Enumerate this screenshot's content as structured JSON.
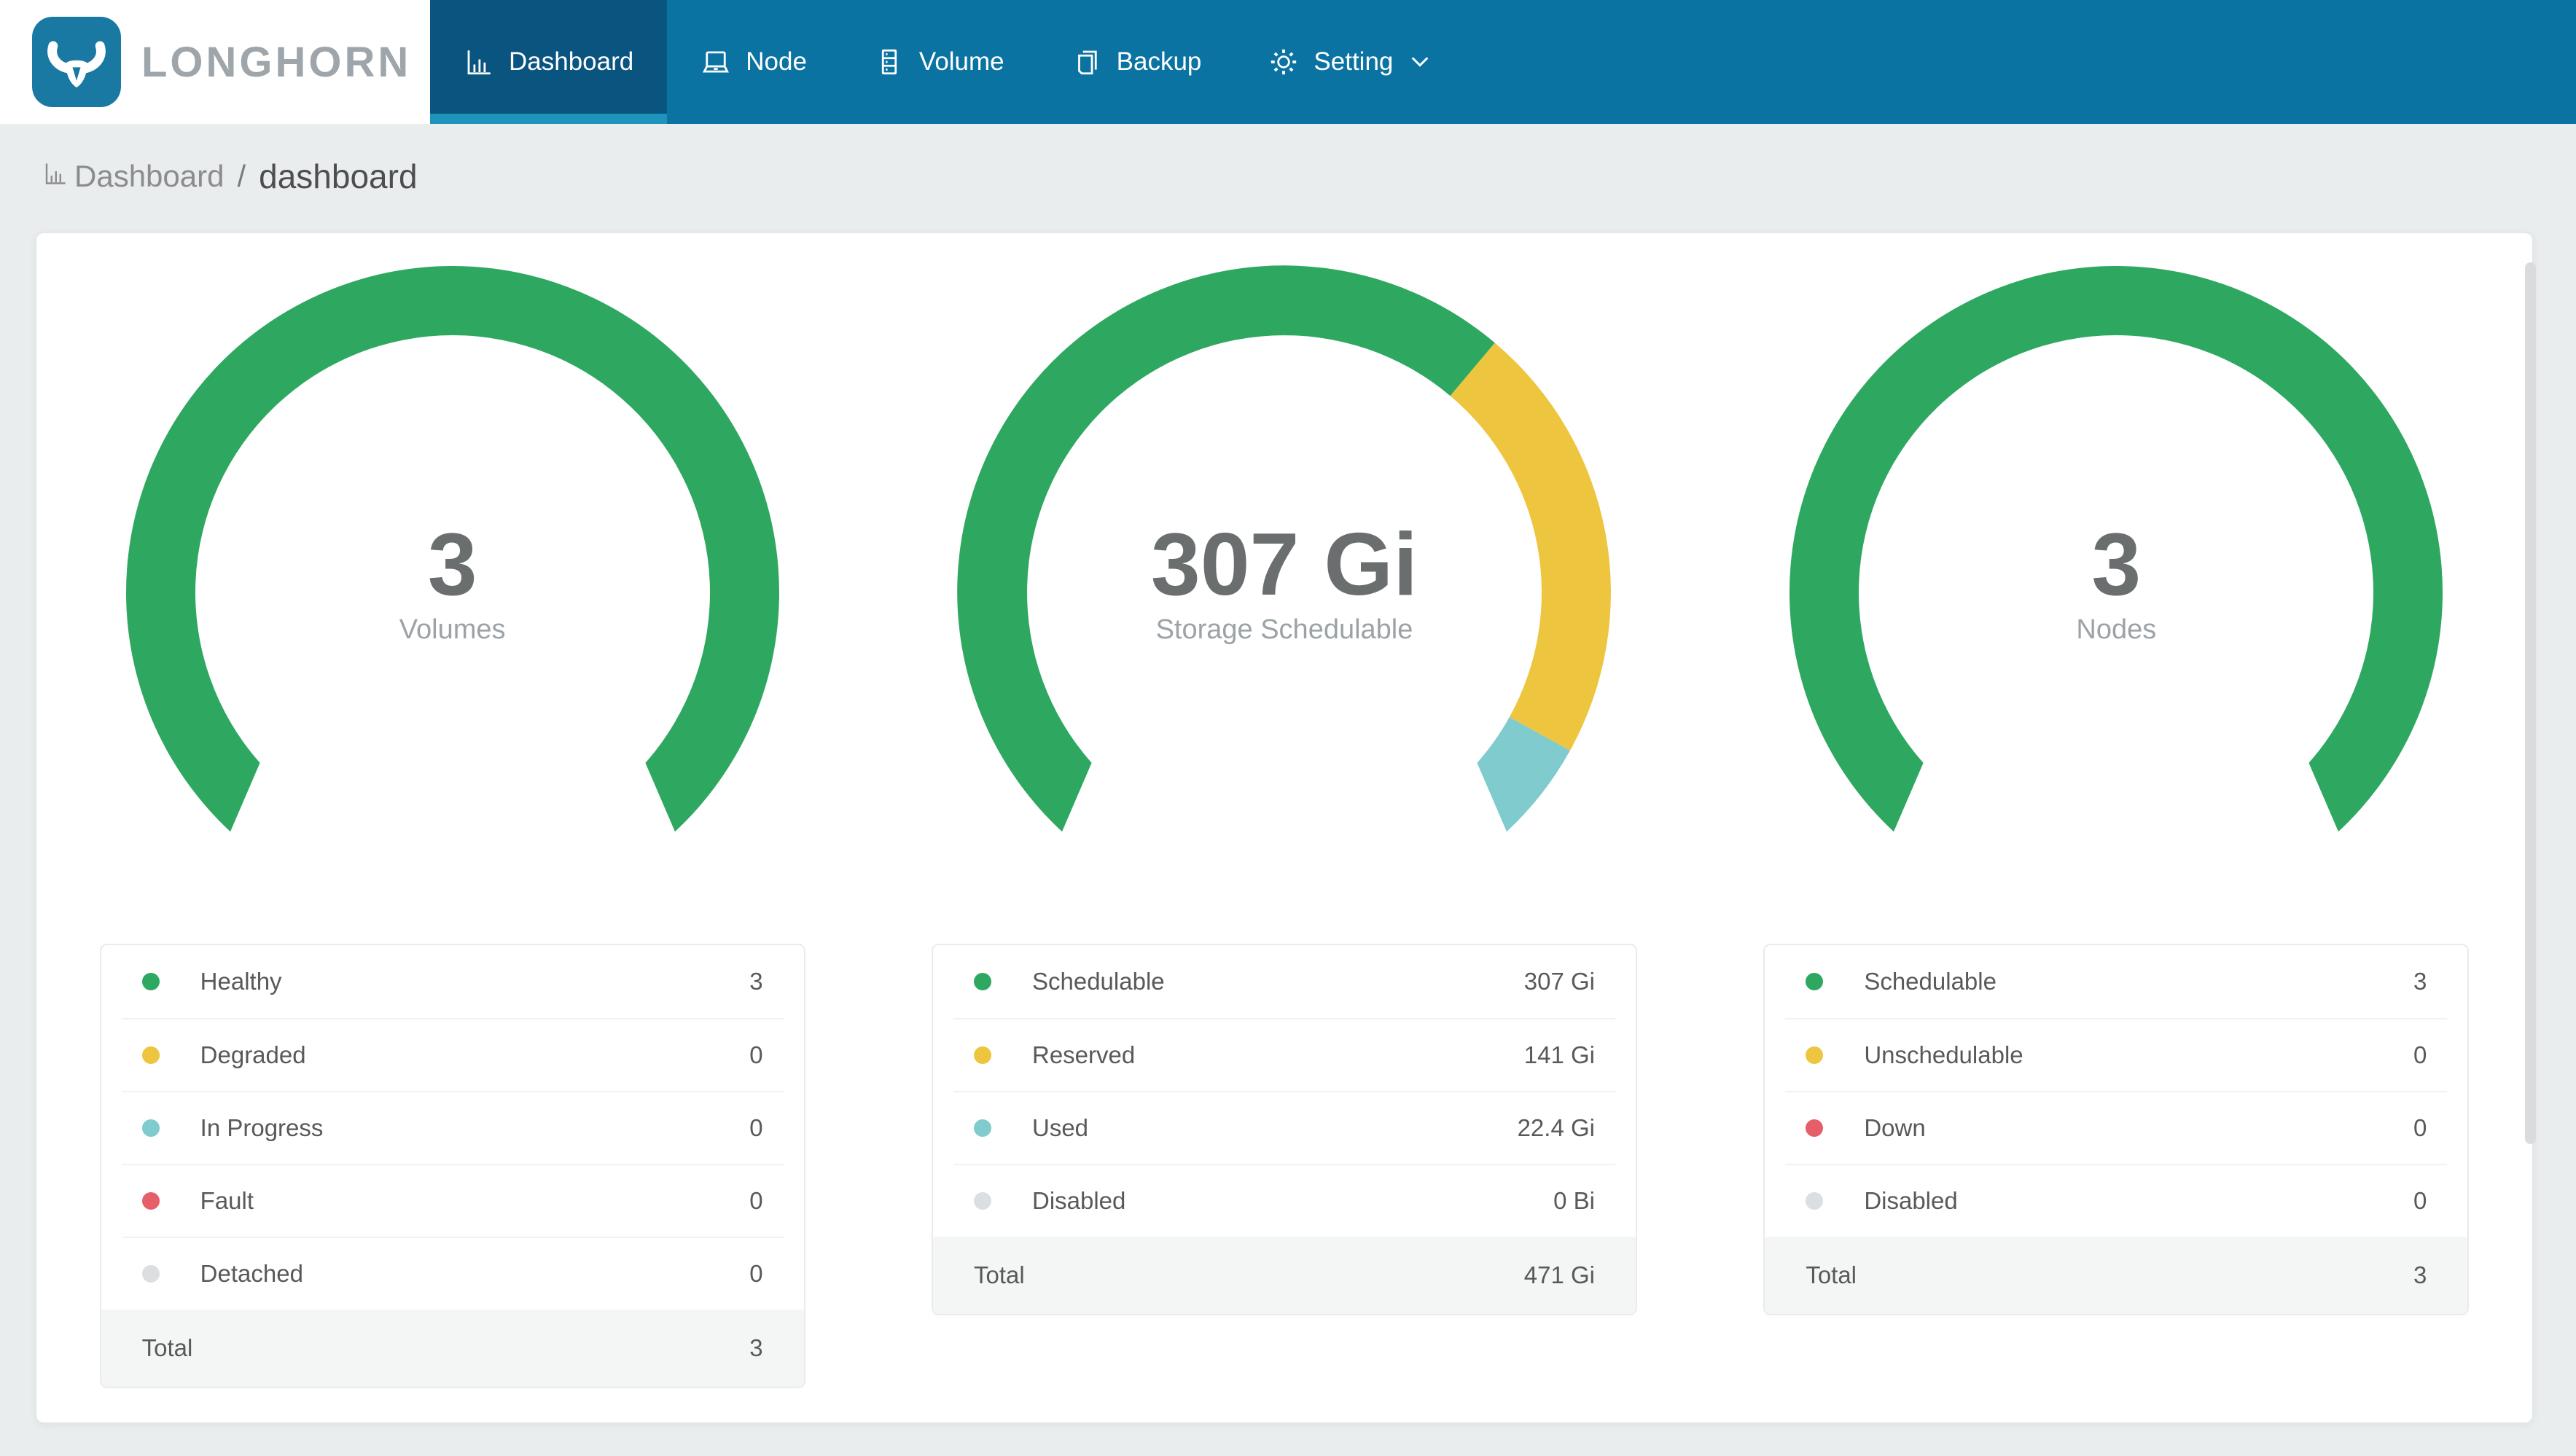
{
  "app": {
    "brand": "LONGHORN"
  },
  "nav": {
    "items": [
      {
        "label": "Dashboard",
        "icon": "bar-chart-icon",
        "active": true
      },
      {
        "label": "Node",
        "icon": "laptop-icon",
        "active": false
      },
      {
        "label": "Volume",
        "icon": "storage-stack-icon",
        "active": false
      },
      {
        "label": "Backup",
        "icon": "copy-pages-icon",
        "active": false
      },
      {
        "label": "Setting",
        "icon": "gear-icon",
        "active": false,
        "has_dropdown": true
      }
    ]
  },
  "breadcrumb": {
    "section": "Dashboard",
    "separator": "/",
    "page": "dashboard"
  },
  "colors": {
    "nav_bg": "#0B73A2",
    "nav_active_bg": "#0A5480",
    "nav_active_underline": "#1E93BB",
    "logo_bg": "#1979A3",
    "brand_text": "#9EA6AB",
    "page_bg": "#E9EDED",
    "green": "#2EA860",
    "yellow": "#EEC53E",
    "teal": "#7FCBCE",
    "red": "#E55E68",
    "gray": "#DBDFE2",
    "text": "#595959",
    "muted_text": "#9BA3A8",
    "center_value_text": "#6B6E6F",
    "total_row_bg": "#F4F6F6"
  },
  "chart_data": [
    {
      "type": "donut-gauge",
      "center_value": "3",
      "center_label": "Volumes",
      "arc": {
        "span_deg": 263,
        "gap_position": "bottom",
        "tip_ext_deg": 5.6
      },
      "series": [
        {
          "label": "Healthy",
          "value": 3,
          "display": "3",
          "color": "#2EA860"
        },
        {
          "label": "Degraded",
          "value": 0,
          "display": "0",
          "color": "#EEC53E"
        },
        {
          "label": "In Progress",
          "value": 0,
          "display": "0",
          "color": "#7FCBCE"
        },
        {
          "label": "Fault",
          "value": 0,
          "display": "0",
          "color": "#E55E68"
        },
        {
          "label": "Detached",
          "value": 0,
          "display": "0",
          "color": "#DBDFE2"
        }
      ],
      "total": {
        "label": "Total",
        "value": 3,
        "display": "3"
      }
    },
    {
      "type": "donut-gauge",
      "center_value": "307 Gi",
      "center_label": "Storage Schedulable",
      "arc": {
        "span_deg": 263,
        "gap_position": "bottom",
        "tip_ext_deg": 5.6
      },
      "series": [
        {
          "label": "Schedulable",
          "value": 307,
          "display": "307 Gi",
          "color": "#2EA860"
        },
        {
          "label": "Reserved",
          "value": 141,
          "display": "141 Gi",
          "color": "#EEC53E"
        },
        {
          "label": "Used",
          "value": 22.4,
          "display": "22.4 Gi",
          "color": "#7FCBCE"
        },
        {
          "label": "Disabled",
          "value": 0,
          "display": "0 Bi",
          "color": "#DBDFE2"
        }
      ],
      "total": {
        "label": "Total",
        "value": 471,
        "display": "471 Gi"
      }
    },
    {
      "type": "donut-gauge",
      "center_value": "3",
      "center_label": "Nodes",
      "arc": {
        "span_deg": 263,
        "gap_position": "bottom",
        "tip_ext_deg": 5.6
      },
      "series": [
        {
          "label": "Schedulable",
          "value": 3,
          "display": "3",
          "color": "#2EA860"
        },
        {
          "label": "Unschedulable",
          "value": 0,
          "display": "0",
          "color": "#EEC53E"
        },
        {
          "label": "Down",
          "value": 0,
          "display": "0",
          "color": "#E55E68"
        },
        {
          "label": "Disabled",
          "value": 0,
          "display": "0",
          "color": "#DBDFE2"
        }
      ],
      "total": {
        "label": "Total",
        "value": 3,
        "display": "3"
      }
    }
  ]
}
